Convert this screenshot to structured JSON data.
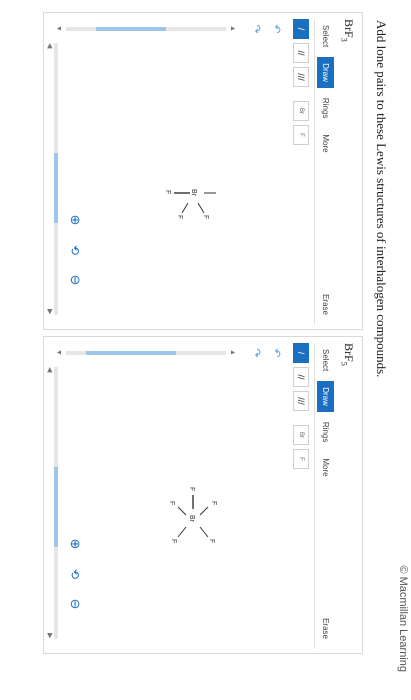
{
  "credit": {
    "mark": "©",
    "text": "Macmillan Learning"
  },
  "instruction": "Add lone pairs to these Lewis structures of interhalogen compounds.",
  "panels": [
    {
      "formula": {
        "base": "BrF",
        "sub": "3"
      },
      "tabs": {
        "select": "Select",
        "draw": "Draw",
        "rings": "Rings",
        "more": "More",
        "erase": "Erase"
      },
      "tools": {
        "single": "/",
        "double": "//",
        "triple": "///",
        "atom1": "Br",
        "atom2": "F"
      },
      "molecule": {
        "center": "Br",
        "ligand": "F"
      }
    },
    {
      "formula": {
        "base": "BrF",
        "sub": "5"
      },
      "tabs": {
        "select": "Select",
        "draw": "Draw",
        "rings": "Rings",
        "more": "More",
        "erase": "Erase"
      },
      "tools": {
        "single": "/",
        "double": "//",
        "triple": "///",
        "atom1": "Br",
        "atom2": "F"
      },
      "molecule": {
        "center": "Br",
        "ligand": "F"
      }
    }
  ],
  "icons": {
    "undo": "undo-icon",
    "redo": "redo-icon",
    "zoom_in": "zoom-in-icon",
    "reset": "reset-view-icon",
    "zoom_out": "zoom-out-icon"
  },
  "colors": {
    "accent": "#1a6fc1",
    "icon": "#5aa0d8",
    "scroll": "#9ec5ea"
  }
}
